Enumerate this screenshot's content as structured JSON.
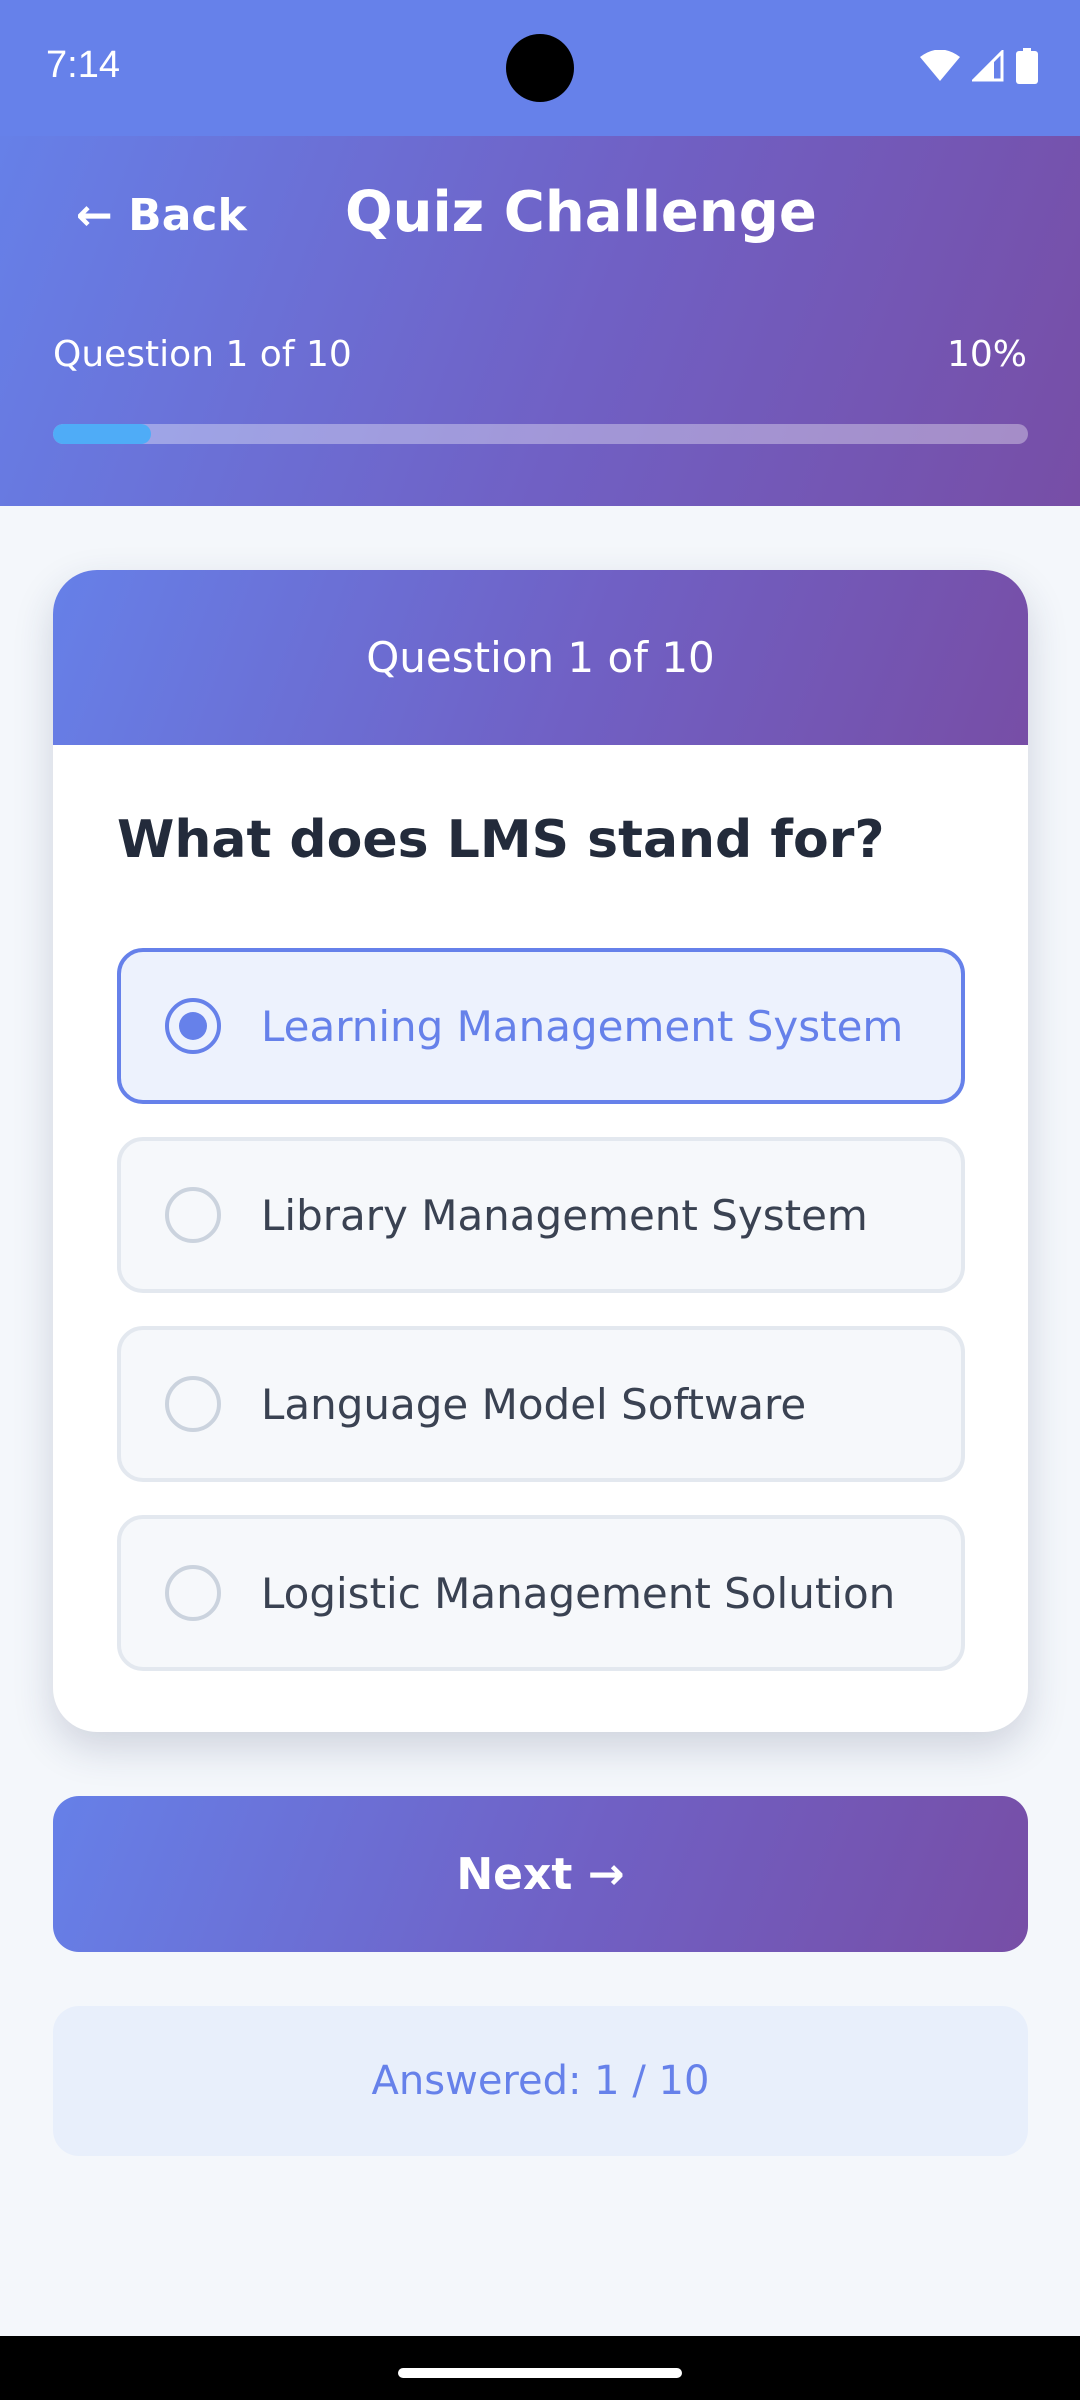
{
  "status_bar": {
    "time": "7:14",
    "icons": [
      "wifi-icon",
      "signal-icon",
      "battery-icon"
    ]
  },
  "header": {
    "back_label": "← Back",
    "title": "Quiz Challenge",
    "progress_label": "Question 1 of 10",
    "progress_percent": "10%",
    "progress_value": 0.1
  },
  "card": {
    "header_label": "Question 1 of 10",
    "question": "What does LMS stand for?",
    "options": [
      {
        "label": "Learning Management System",
        "selected": true
      },
      {
        "label": "Library Management System",
        "selected": false
      },
      {
        "label": "Language Model Software",
        "selected": false
      },
      {
        "label": "Logistic Management Solution",
        "selected": false
      }
    ]
  },
  "next_label": "Next →",
  "answered_label": "Answered: 1 / 10",
  "colors": {
    "accent": "#6681ea",
    "gradient_end": "#774ea6",
    "progress_fill": "#4facf7"
  }
}
